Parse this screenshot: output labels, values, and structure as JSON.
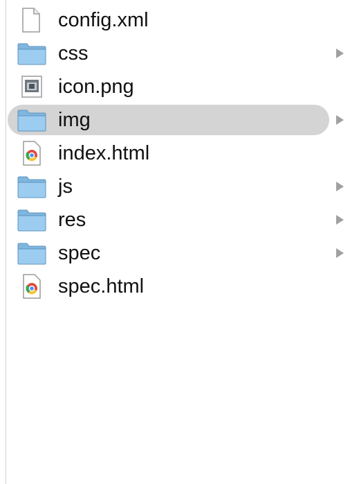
{
  "column": {
    "items": [
      {
        "name": "config.xml",
        "kind": "document-icon",
        "has_children": false,
        "selected": false
      },
      {
        "name": "css",
        "kind": "folder-icon",
        "has_children": true,
        "selected": false
      },
      {
        "name": "icon.png",
        "kind": "image-file-icon",
        "has_children": false,
        "selected": false
      },
      {
        "name": "img",
        "kind": "folder-icon",
        "has_children": true,
        "selected": true
      },
      {
        "name": "index.html",
        "kind": "html-file-icon",
        "has_children": false,
        "selected": false
      },
      {
        "name": "js",
        "kind": "folder-icon",
        "has_children": true,
        "selected": false
      },
      {
        "name": "res",
        "kind": "folder-icon",
        "has_children": true,
        "selected": false
      },
      {
        "name": "spec",
        "kind": "folder-icon",
        "has_children": true,
        "selected": false
      },
      {
        "name": "spec.html",
        "kind": "html-file-icon",
        "has_children": false,
        "selected": false
      }
    ]
  },
  "colors": {
    "selection": "#d4d4d4",
    "folder": "#8ec4ea",
    "chevron": "#a0a0a0"
  }
}
